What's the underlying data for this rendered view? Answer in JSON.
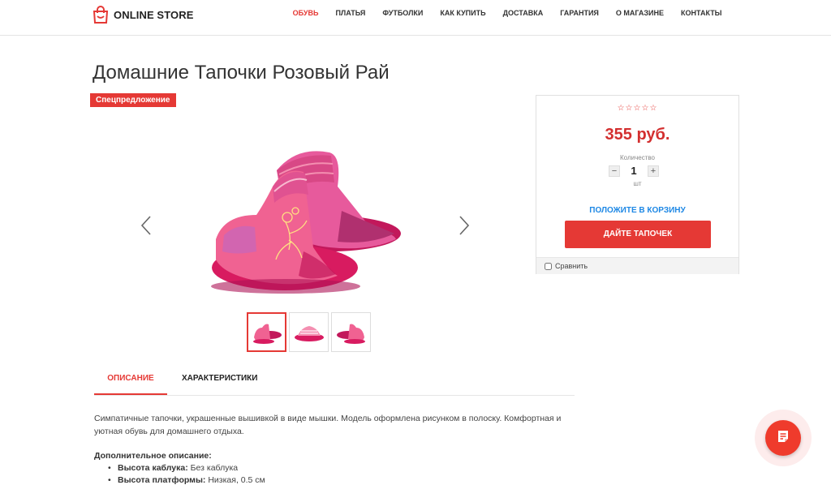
{
  "header": {
    "logo_text": "ONLINE STORE",
    "nav": [
      "ОБУВЬ",
      "ПЛАТЬЯ",
      "ФУТБОЛКИ",
      "КАК КУПИТЬ",
      "ДОСТАВКА",
      "ГАРАНТИЯ",
      "О МАГАЗИНЕ",
      "КОНТАКТЫ"
    ],
    "active_nav": "ОБУВЬ"
  },
  "product": {
    "title": "Домашние Тапочки Розовый Рай",
    "badge": "Спецпредложение",
    "rating_stars": 0,
    "rating_max": 5,
    "price": "355 руб.",
    "quantity_label": "Количество",
    "quantity": "1",
    "quantity_unit": "шт",
    "quantity_minus": "−",
    "quantity_plus": "+",
    "add_to_cart": "ПОЛОЖИТЕ В КОРЗИНУ",
    "buy_button": "ДАЙТЕ ТАПОЧЕК",
    "compare_label": "Сравнить"
  },
  "tabs": [
    "ОПИСАНИЕ",
    "ХАРАКТЕРИСТИКИ"
  ],
  "description": {
    "text": "Симпатичные тапочки, украшенные вышивкой в виде мышки. Модель оформлена рисунком в полоску. Комфортная и уютная обувь для домашнего отдыха.",
    "extra_title": "Дополнительное описание:",
    "extra": [
      {
        "label": "Высота каблука:",
        "value": "Без каблука"
      },
      {
        "label": "Высота платформы:",
        "value": "Низкая, 0.5 см"
      }
    ]
  },
  "colors": {
    "accent": "#e53935",
    "link": "#1e88e5"
  },
  "icons": {
    "logo": "shopping-bag-icon",
    "prev": "chevron-left-icon",
    "next": "chevron-right-icon",
    "chat": "chat-note-icon"
  }
}
